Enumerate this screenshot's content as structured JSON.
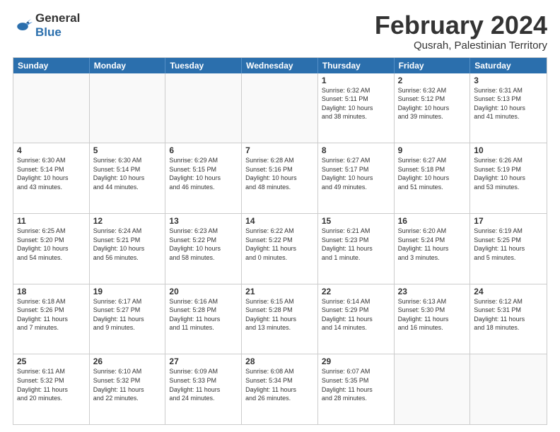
{
  "logo": {
    "line1": "General",
    "line2": "Blue"
  },
  "title": "February 2024",
  "location": "Qusrah, Palestinian Territory",
  "weekdays": [
    "Sunday",
    "Monday",
    "Tuesday",
    "Wednesday",
    "Thursday",
    "Friday",
    "Saturday"
  ],
  "rows": [
    [
      {
        "day": "",
        "info": "",
        "empty": true
      },
      {
        "day": "",
        "info": "",
        "empty": true
      },
      {
        "day": "",
        "info": "",
        "empty": true
      },
      {
        "day": "",
        "info": "",
        "empty": true
      },
      {
        "day": "1",
        "info": "Sunrise: 6:32 AM\nSunset: 5:11 PM\nDaylight: 10 hours\nand 38 minutes."
      },
      {
        "day": "2",
        "info": "Sunrise: 6:32 AM\nSunset: 5:12 PM\nDaylight: 10 hours\nand 39 minutes."
      },
      {
        "day": "3",
        "info": "Sunrise: 6:31 AM\nSunset: 5:13 PM\nDaylight: 10 hours\nand 41 minutes."
      }
    ],
    [
      {
        "day": "4",
        "info": "Sunrise: 6:30 AM\nSunset: 5:14 PM\nDaylight: 10 hours\nand 43 minutes."
      },
      {
        "day": "5",
        "info": "Sunrise: 6:30 AM\nSunset: 5:14 PM\nDaylight: 10 hours\nand 44 minutes."
      },
      {
        "day": "6",
        "info": "Sunrise: 6:29 AM\nSunset: 5:15 PM\nDaylight: 10 hours\nand 46 minutes."
      },
      {
        "day": "7",
        "info": "Sunrise: 6:28 AM\nSunset: 5:16 PM\nDaylight: 10 hours\nand 48 minutes."
      },
      {
        "day": "8",
        "info": "Sunrise: 6:27 AM\nSunset: 5:17 PM\nDaylight: 10 hours\nand 49 minutes."
      },
      {
        "day": "9",
        "info": "Sunrise: 6:27 AM\nSunset: 5:18 PM\nDaylight: 10 hours\nand 51 minutes."
      },
      {
        "day": "10",
        "info": "Sunrise: 6:26 AM\nSunset: 5:19 PM\nDaylight: 10 hours\nand 53 minutes."
      }
    ],
    [
      {
        "day": "11",
        "info": "Sunrise: 6:25 AM\nSunset: 5:20 PM\nDaylight: 10 hours\nand 54 minutes."
      },
      {
        "day": "12",
        "info": "Sunrise: 6:24 AM\nSunset: 5:21 PM\nDaylight: 10 hours\nand 56 minutes."
      },
      {
        "day": "13",
        "info": "Sunrise: 6:23 AM\nSunset: 5:22 PM\nDaylight: 10 hours\nand 58 minutes."
      },
      {
        "day": "14",
        "info": "Sunrise: 6:22 AM\nSunset: 5:22 PM\nDaylight: 11 hours\nand 0 minutes."
      },
      {
        "day": "15",
        "info": "Sunrise: 6:21 AM\nSunset: 5:23 PM\nDaylight: 11 hours\nand 1 minute."
      },
      {
        "day": "16",
        "info": "Sunrise: 6:20 AM\nSunset: 5:24 PM\nDaylight: 11 hours\nand 3 minutes."
      },
      {
        "day": "17",
        "info": "Sunrise: 6:19 AM\nSunset: 5:25 PM\nDaylight: 11 hours\nand 5 minutes."
      }
    ],
    [
      {
        "day": "18",
        "info": "Sunrise: 6:18 AM\nSunset: 5:26 PM\nDaylight: 11 hours\nand 7 minutes."
      },
      {
        "day": "19",
        "info": "Sunrise: 6:17 AM\nSunset: 5:27 PM\nDaylight: 11 hours\nand 9 minutes."
      },
      {
        "day": "20",
        "info": "Sunrise: 6:16 AM\nSunset: 5:28 PM\nDaylight: 11 hours\nand 11 minutes."
      },
      {
        "day": "21",
        "info": "Sunrise: 6:15 AM\nSunset: 5:28 PM\nDaylight: 11 hours\nand 13 minutes."
      },
      {
        "day": "22",
        "info": "Sunrise: 6:14 AM\nSunset: 5:29 PM\nDaylight: 11 hours\nand 14 minutes."
      },
      {
        "day": "23",
        "info": "Sunrise: 6:13 AM\nSunset: 5:30 PM\nDaylight: 11 hours\nand 16 minutes."
      },
      {
        "day": "24",
        "info": "Sunrise: 6:12 AM\nSunset: 5:31 PM\nDaylight: 11 hours\nand 18 minutes."
      }
    ],
    [
      {
        "day": "25",
        "info": "Sunrise: 6:11 AM\nSunset: 5:32 PM\nDaylight: 11 hours\nand 20 minutes."
      },
      {
        "day": "26",
        "info": "Sunrise: 6:10 AM\nSunset: 5:32 PM\nDaylight: 11 hours\nand 22 minutes."
      },
      {
        "day": "27",
        "info": "Sunrise: 6:09 AM\nSunset: 5:33 PM\nDaylight: 11 hours\nand 24 minutes."
      },
      {
        "day": "28",
        "info": "Sunrise: 6:08 AM\nSunset: 5:34 PM\nDaylight: 11 hours\nand 26 minutes."
      },
      {
        "day": "29",
        "info": "Sunrise: 6:07 AM\nSunset: 5:35 PM\nDaylight: 11 hours\nand 28 minutes."
      },
      {
        "day": "",
        "info": "",
        "empty": true
      },
      {
        "day": "",
        "info": "",
        "empty": true
      }
    ]
  ]
}
